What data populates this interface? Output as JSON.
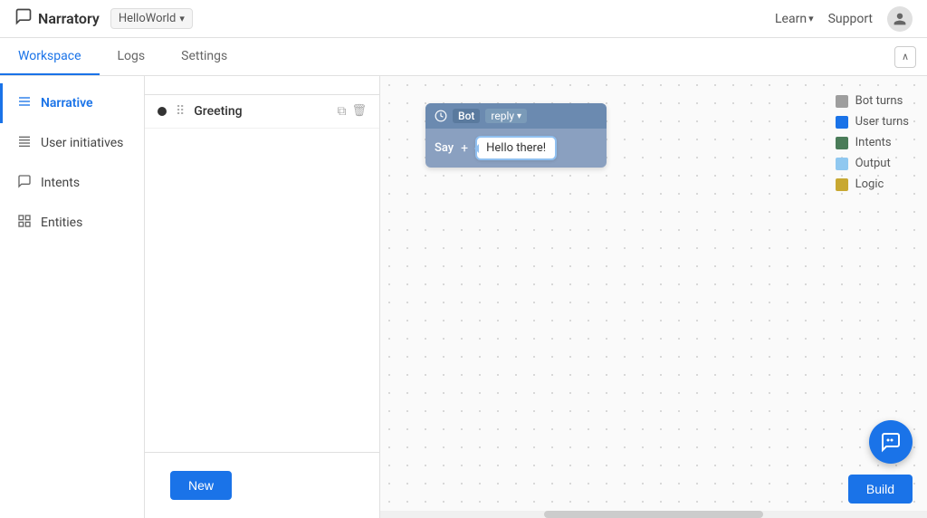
{
  "app": {
    "logo_text": "Narratory",
    "logo_icon": "💬"
  },
  "workspace_selector": {
    "label": "HelloWorld",
    "dropdown_icon": "▾"
  },
  "top_nav": {
    "learn_label": "Learn",
    "learn_dropdown": "▾",
    "support_label": "Support"
  },
  "tabs": [
    {
      "id": "workspace",
      "label": "Workspace",
      "active": true
    },
    {
      "id": "logs",
      "label": "Logs",
      "active": false
    },
    {
      "id": "settings",
      "label": "Settings",
      "active": false
    }
  ],
  "collapse_btn": "∧",
  "sidebar": {
    "items": [
      {
        "id": "narrative",
        "label": "Narrative",
        "icon": "≡",
        "active": true
      },
      {
        "id": "user-initiatives",
        "label": "User initiatives",
        "icon": "≈",
        "active": false
      },
      {
        "id": "intents",
        "label": "Intents",
        "icon": "💬",
        "active": false
      },
      {
        "id": "entities",
        "label": "Entities",
        "icon": "⊞",
        "active": false
      }
    ]
  },
  "story_panel": {
    "story": {
      "name": "Greeting",
      "copy_icon": "⧉",
      "delete_icon": "🗑"
    }
  },
  "new_button": "New",
  "canvas": {
    "bot_block": {
      "bot_label": "Bot",
      "reply_label": "reply",
      "say_label": "Say",
      "plus_label": "+",
      "hello_text": "Hello there!"
    }
  },
  "legend": {
    "items": [
      {
        "label": "Bot turns",
        "color": "#9e9e9e"
      },
      {
        "label": "User turns",
        "color": "#1a73e8"
      },
      {
        "label": "Intents",
        "color": "#4a7c59"
      },
      {
        "label": "Output",
        "color": "#90c8f0"
      },
      {
        "label": "Logic",
        "color": "#c8a832"
      }
    ]
  },
  "build_button": "Build"
}
